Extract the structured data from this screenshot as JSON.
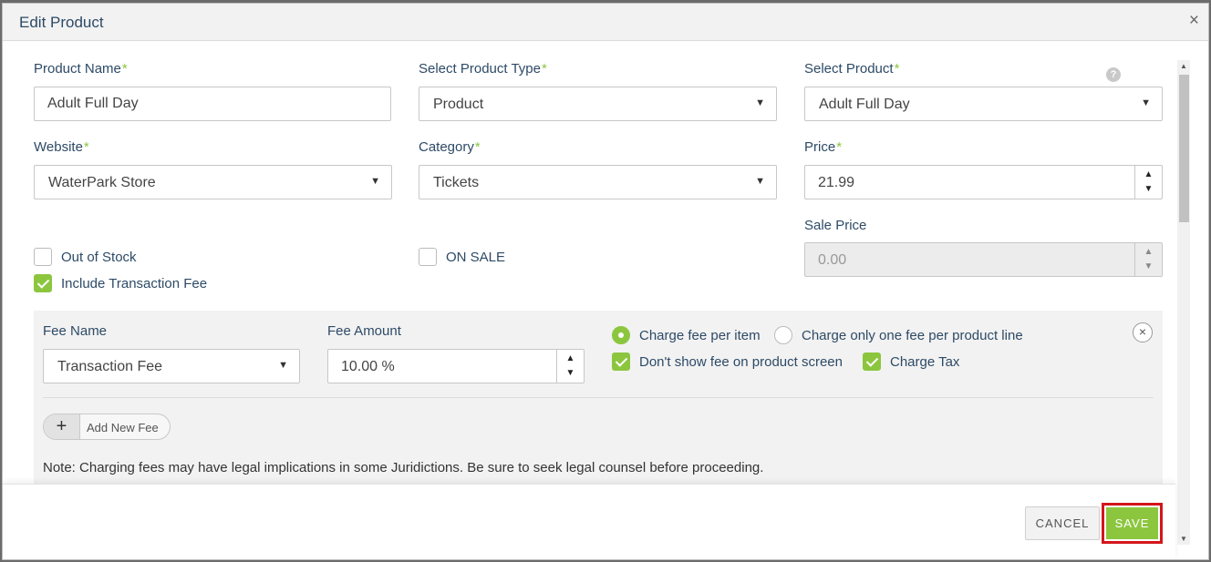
{
  "dialog": {
    "title": "Edit Product",
    "close_glyph": "×",
    "help_glyph": "?",
    "required_mark": "*"
  },
  "fields": {
    "product_name": {
      "label": "Product Name",
      "value": "Adult Full Day"
    },
    "product_type": {
      "label": "Select Product Type",
      "value": "Product"
    },
    "select_product": {
      "label": "Select Product",
      "value": "Adult Full Day"
    },
    "website": {
      "label": "Website",
      "value": "WaterPark Store"
    },
    "category": {
      "label": "Category",
      "value": "Tickets"
    },
    "price": {
      "label": "Price",
      "value": "21.99"
    },
    "sale_price": {
      "label": "Sale Price",
      "value": "0.00"
    }
  },
  "checks": {
    "out_of_stock": {
      "label": "Out of Stock",
      "checked": false
    },
    "on_sale": {
      "label": "ON SALE",
      "checked": false
    },
    "include_fee": {
      "label": "Include Transaction Fee",
      "checked": true
    }
  },
  "fee": {
    "name_label": "Fee Name",
    "name_value": "Transaction Fee",
    "amount_label": "Fee Amount",
    "amount_value": "10.00 %",
    "charge_per_item": "Charge fee per item",
    "charge_one_per_line": "Charge only one fee per product line",
    "dont_show_fee": "Don't show fee on product screen",
    "charge_tax": "Charge Tax",
    "remove_glyph": "×",
    "add_plus": "+",
    "add_label": "Add New Fee",
    "note": "Note: Charging fees may have legal implications in some Juridictions. Be sure to seek legal counsel before proceeding."
  },
  "spinner": {
    "up": "▲",
    "down": "▼"
  },
  "select_caret": "▼",
  "footer": {
    "cancel": "CANCEL",
    "save": "SAVE"
  },
  "colors": {
    "accent": "#8cc63f",
    "label": "#2d4a66",
    "highlight": "#d3161b"
  }
}
